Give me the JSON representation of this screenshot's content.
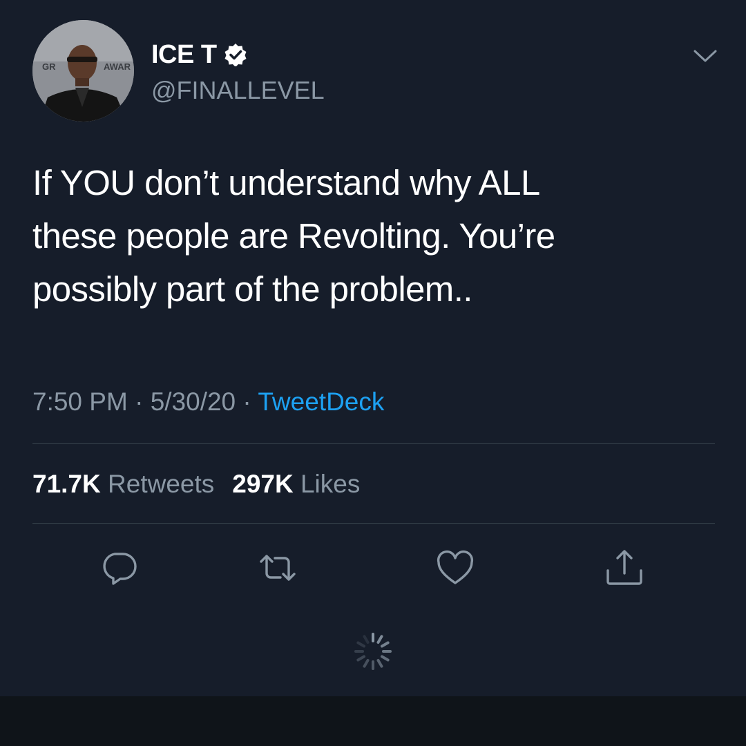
{
  "author": {
    "display_name": "ICE T",
    "handle": "@FINALLEVEL",
    "verified": true,
    "avatar_backdrop_text": [
      "GR",
      "AWAR"
    ]
  },
  "tweet": {
    "text": "If YOU don’t understand why ALL\nthese people are Revolting.  You’re\npossibly part of the problem..",
    "time": "7:50 PM",
    "date": "5/30/20",
    "separator": "·",
    "source": "TweetDeck"
  },
  "stats": {
    "retweets_count": "71.7K",
    "retweets_label": "Retweets",
    "likes_count": "297K",
    "likes_label": "Likes"
  },
  "actions": [
    "reply-icon",
    "retweet-icon",
    "like-icon",
    "share-icon"
  ],
  "colors": {
    "background": "#161d2a",
    "primary_text": "#ffffff",
    "secondary_text": "#8b98a5",
    "link": "#1da1f2",
    "divider": "#38444d"
  }
}
